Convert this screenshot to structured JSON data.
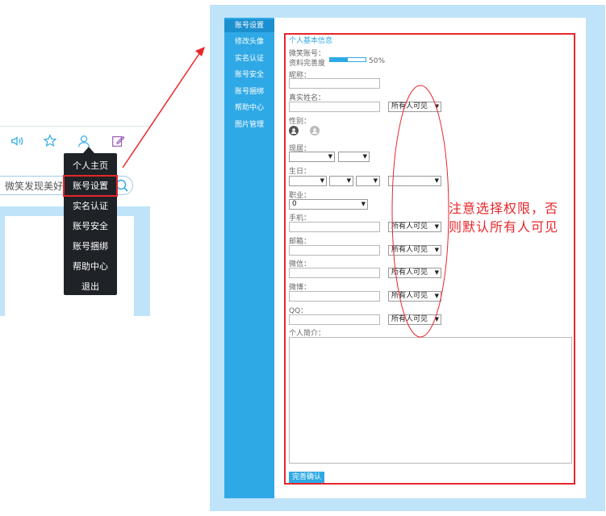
{
  "search": {
    "value": "微笑发现美好"
  },
  "menu": {
    "items": [
      {
        "label": "个人主页"
      },
      {
        "label": "账号设置"
      },
      {
        "label": "实名认证"
      },
      {
        "label": "账号安全"
      },
      {
        "label": "账号捆绑"
      },
      {
        "label": "帮助中心"
      },
      {
        "label": "退出"
      }
    ],
    "selected": "账号设置"
  },
  "sidebar": {
    "items": [
      {
        "label": "账号设置"
      },
      {
        "label": "修改头像"
      },
      {
        "label": "实名认证"
      },
      {
        "label": "账号安全"
      },
      {
        "label": "账号捆绑"
      },
      {
        "label": "帮助中心"
      },
      {
        "label": "图片管理"
      }
    ],
    "active": "账号设置"
  },
  "form": {
    "section_title": "个人基本信息",
    "account_label": "微笑账号：",
    "completion_label": "资料完善度",
    "completion_value": "50%",
    "completion_fraction": 0.5,
    "nickname_label": "昵称：",
    "realname_label": "真实姓名：",
    "gender_label": "性别：",
    "residence_label": "现居：",
    "birthday_label": "生日：",
    "job_label": "职业：",
    "job_value": "0",
    "phone_label": "手机：",
    "email_label": "邮箱：",
    "wechat_label": "微信：",
    "weibo_label": "微博：",
    "qq_label": "QQ：",
    "intro_label": "个人简介：",
    "visibility_option": "所有人可见",
    "submit_label": "完善确认"
  },
  "annotation": {
    "note_line1": "注意选择权限，否",
    "note_line2": "则默认所有人可见"
  },
  "colors": {
    "accent_blue": "#2fa9e6",
    "frame_blue": "#bfe3f8",
    "annotation_red": "#e8262a",
    "menu_bg": "#1f2328"
  }
}
